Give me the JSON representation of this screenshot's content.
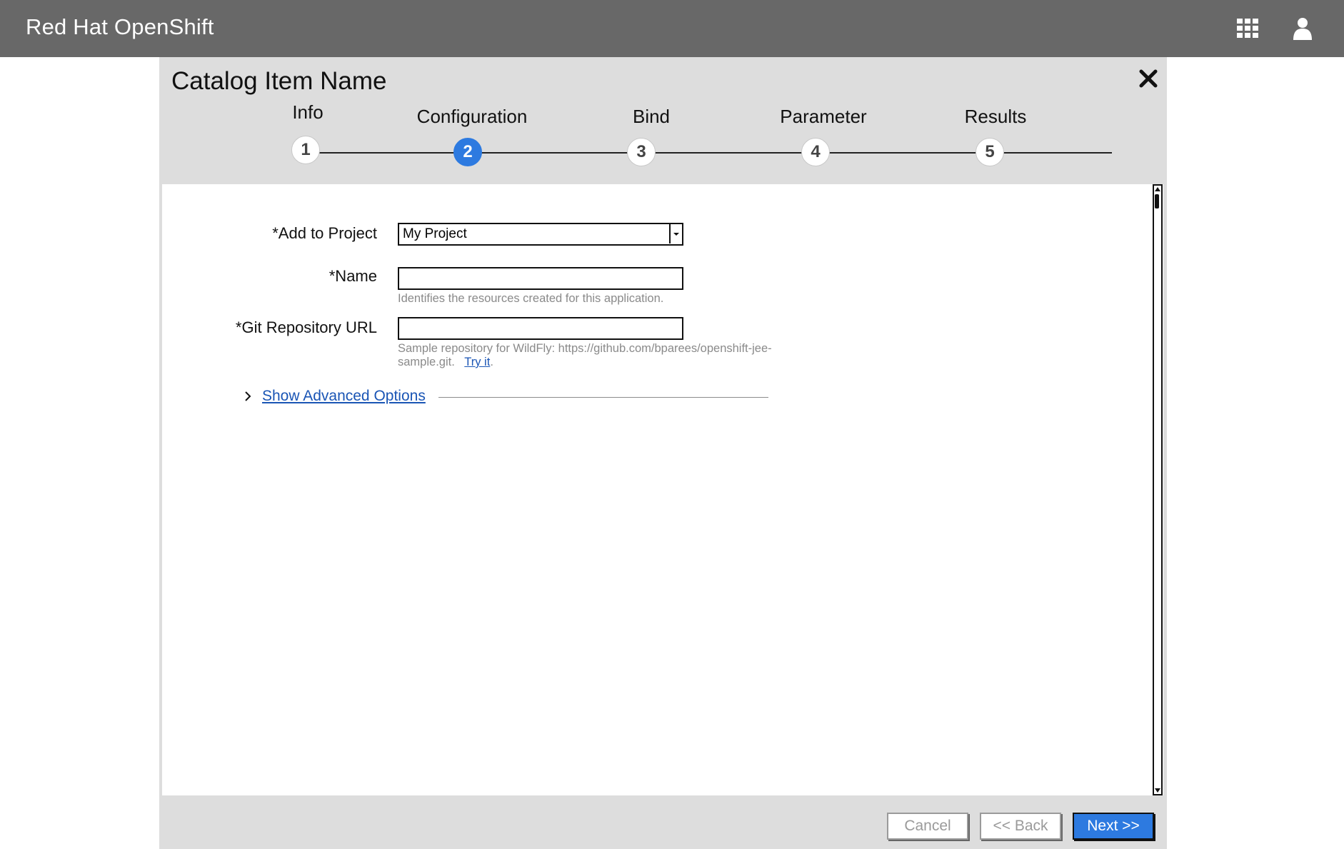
{
  "navbar": {
    "brand": "Red Hat OpenShift",
    "icons": [
      "apps-grid-icon",
      "user-icon"
    ]
  },
  "wizard": {
    "title": "Catalog Item Name",
    "steps": [
      {
        "label": "Info",
        "number": "1",
        "active": false
      },
      {
        "label": "Configuration",
        "number": "2",
        "active": true
      },
      {
        "label": "Bind",
        "number": "3",
        "active": false
      },
      {
        "label": "Parameter",
        "number": "4",
        "active": false
      },
      {
        "label": "Results",
        "number": "5",
        "active": false
      }
    ]
  },
  "form": {
    "project_label": "*Add to Project",
    "project_value": "My Project",
    "name_label": "*Name",
    "name_value": "",
    "name_help": "Identifies the resources created for this application.",
    "git_label": "*Git Repository URL",
    "git_value": "",
    "git_help_prefix": "Sample repository for WildFly: https://github.com/bparees/openshift-jee-sample.git.",
    "git_help_link": "Try it",
    "git_help_suffix": ".",
    "advanced_options": "Show Advanced Options"
  },
  "footer": {
    "cancel": "Cancel",
    "back": "<< Back",
    "next": "Next >>"
  },
  "colors": {
    "navbar": "#686868",
    "modal": "#dddddd",
    "accent": "#2d7ae0",
    "link": "#1a55b5"
  }
}
